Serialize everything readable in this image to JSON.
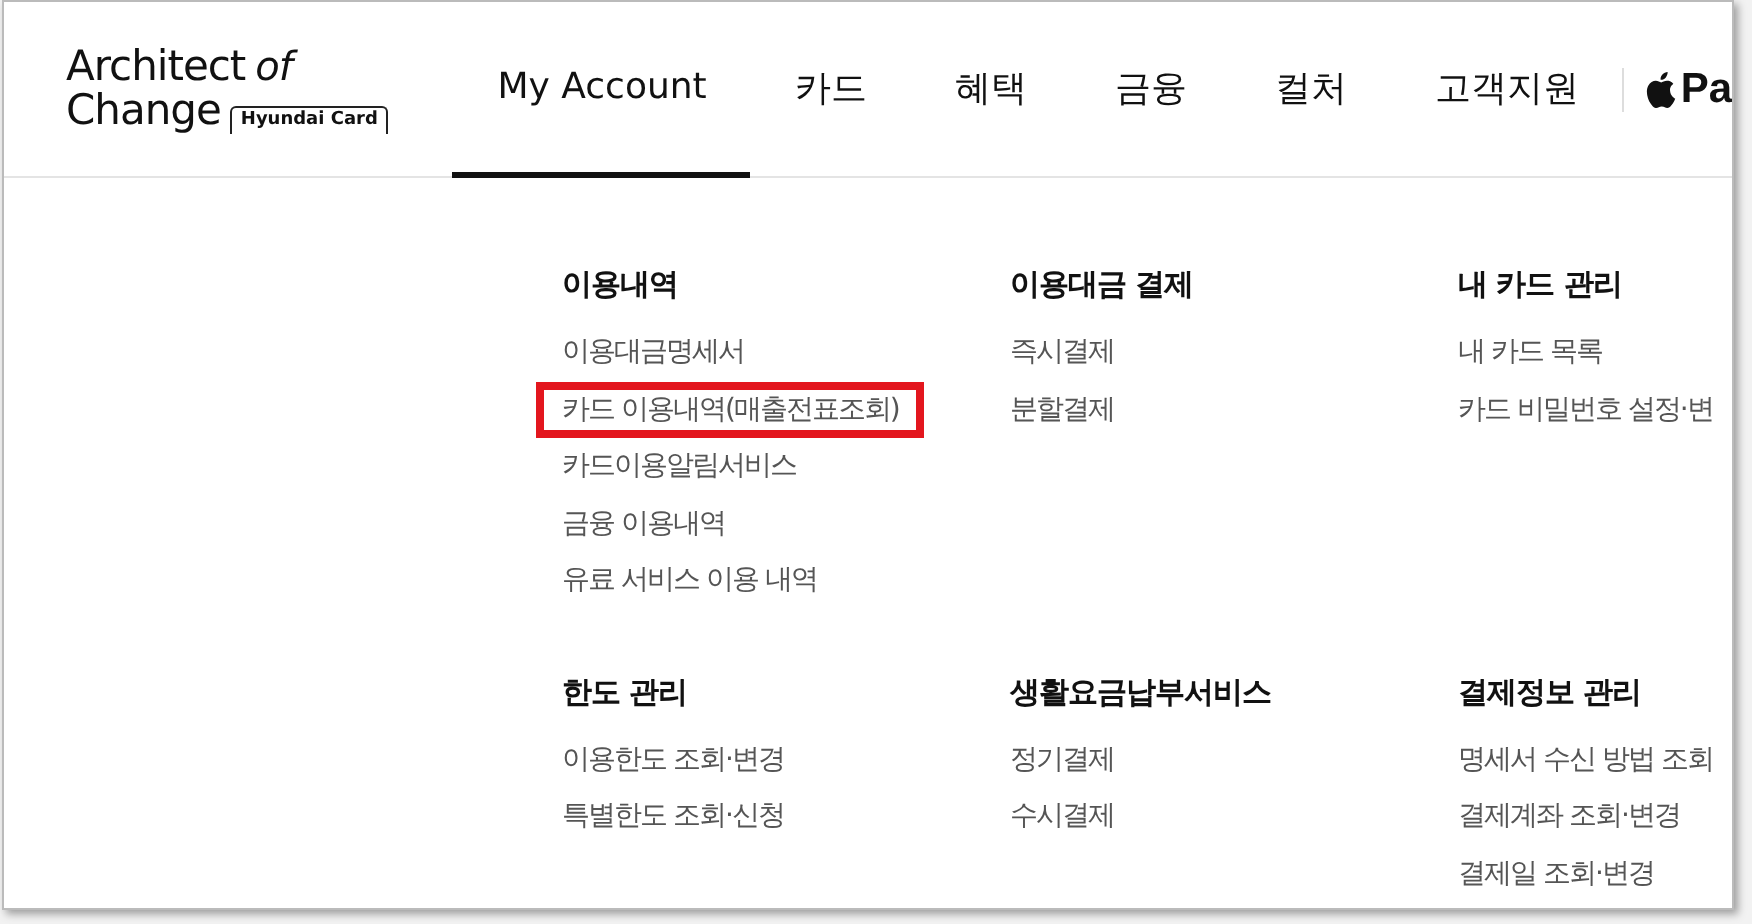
{
  "logo": {
    "line1": "Architect",
    "accent": "of",
    "line2": "Change",
    "badge": "Hyundai Card"
  },
  "nav": [
    {
      "label": "My Account",
      "selected": true
    },
    {
      "label": "카드",
      "selected": false
    },
    {
      "label": "혜택",
      "selected": false
    },
    {
      "label": "금융",
      "selected": false
    },
    {
      "label": "컬처",
      "selected": false
    },
    {
      "label": "고객지원",
      "selected": false
    }
  ],
  "pay": {
    "label": "Pa"
  },
  "menu_rows": [
    [
      {
        "heading": "이용내역",
        "items": [
          {
            "label": "이용대금명세서",
            "highlighted": false
          },
          {
            "label": "카드 이용내역(매출전표조회)",
            "highlighted": true
          },
          {
            "label": "카드이용알림서비스",
            "highlighted": false
          },
          {
            "label": "금융 이용내역",
            "highlighted": false
          },
          {
            "label": "유료 서비스 이용 내역",
            "highlighted": false
          }
        ]
      },
      {
        "heading": "이용대금 결제",
        "items": [
          {
            "label": "즉시결제",
            "highlighted": false
          },
          {
            "label": "분할결제",
            "highlighted": false
          }
        ]
      },
      {
        "heading": "내 카드 관리",
        "items": [
          {
            "label": "내 카드 목록",
            "highlighted": false
          },
          {
            "label": "카드 비밀번호 설정·변",
            "highlighted": false
          }
        ]
      }
    ],
    [
      {
        "heading": "한도 관리",
        "items": [
          {
            "label": "이용한도 조회·변경",
            "highlighted": false
          },
          {
            "label": "특별한도 조회·신청",
            "highlighted": false
          }
        ]
      },
      {
        "heading": "생활요금납부서비스",
        "items": [
          {
            "label": "정기결제",
            "highlighted": false
          },
          {
            "label": "수시결제",
            "highlighted": false
          }
        ]
      },
      {
        "heading": "결제정보 관리",
        "items": [
          {
            "label": "명세서 수신 방법 조회",
            "highlighted": false
          },
          {
            "label": "결제계좌 조회·변경",
            "highlighted": false
          },
          {
            "label": "결제일 조회·변경",
            "highlighted": false
          }
        ]
      }
    ]
  ]
}
